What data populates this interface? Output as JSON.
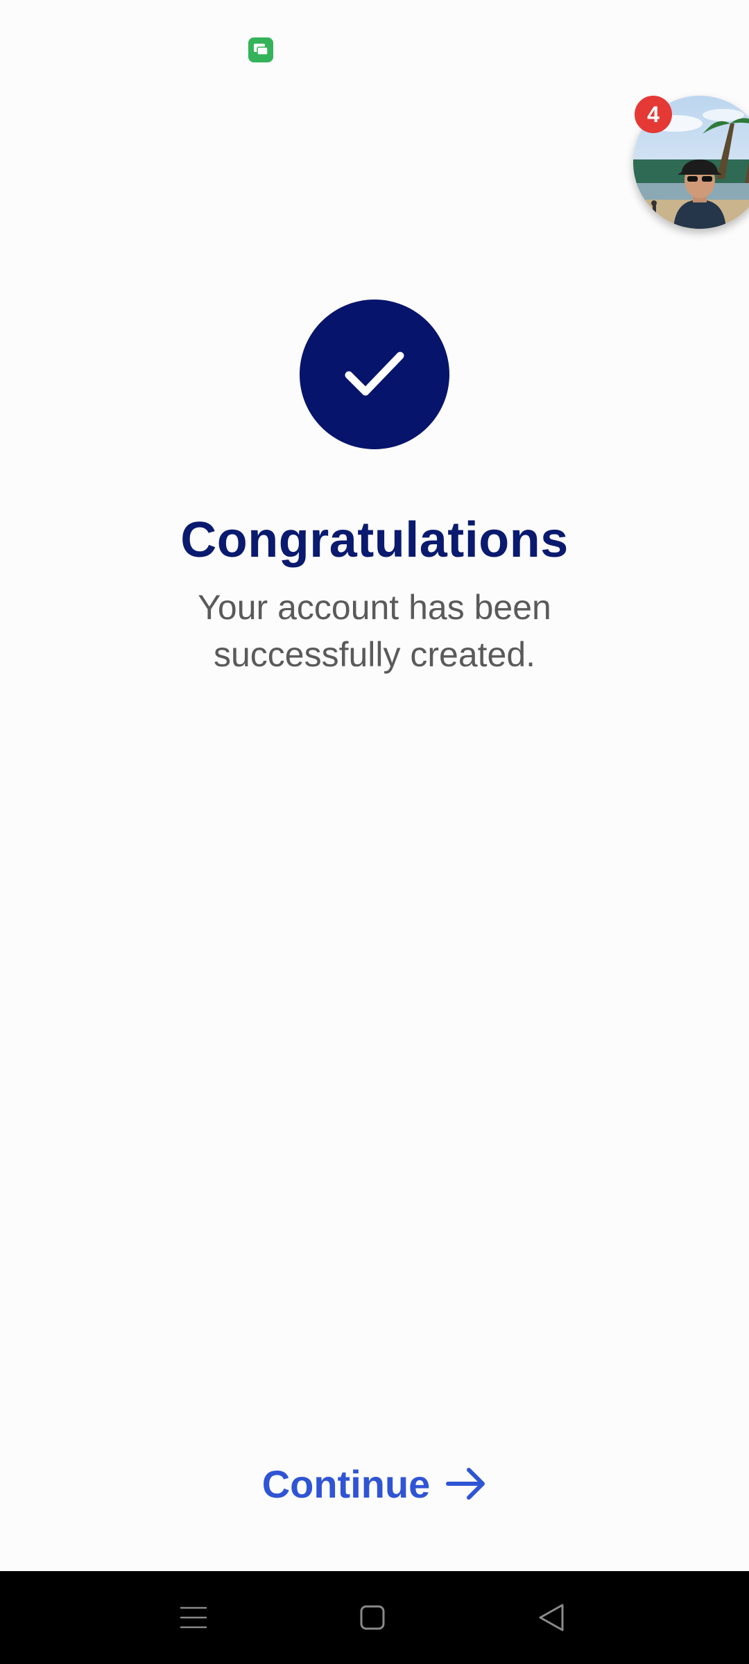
{
  "status_bar": {
    "app_icon": "chat-app-icon"
  },
  "chat_head": {
    "badge_count": "4",
    "avatar": "profile-photo-beach"
  },
  "success": {
    "icon": "checkmark-icon",
    "title": "Congratulations",
    "message_line1": "Your account has been",
    "message_line2": "successfully created."
  },
  "actions": {
    "continue_label": "Continue",
    "continue_icon": "arrow-right-icon"
  },
  "nav": {
    "recents_icon": "menu-icon",
    "home_icon": "home-square-icon",
    "back_icon": "back-triangle-icon"
  },
  "colors": {
    "primary_dark": "#07146b",
    "title": "#0a1a6e",
    "accent": "#2f55d4",
    "badge": "#e53935",
    "status_icon": "#34b35a"
  }
}
